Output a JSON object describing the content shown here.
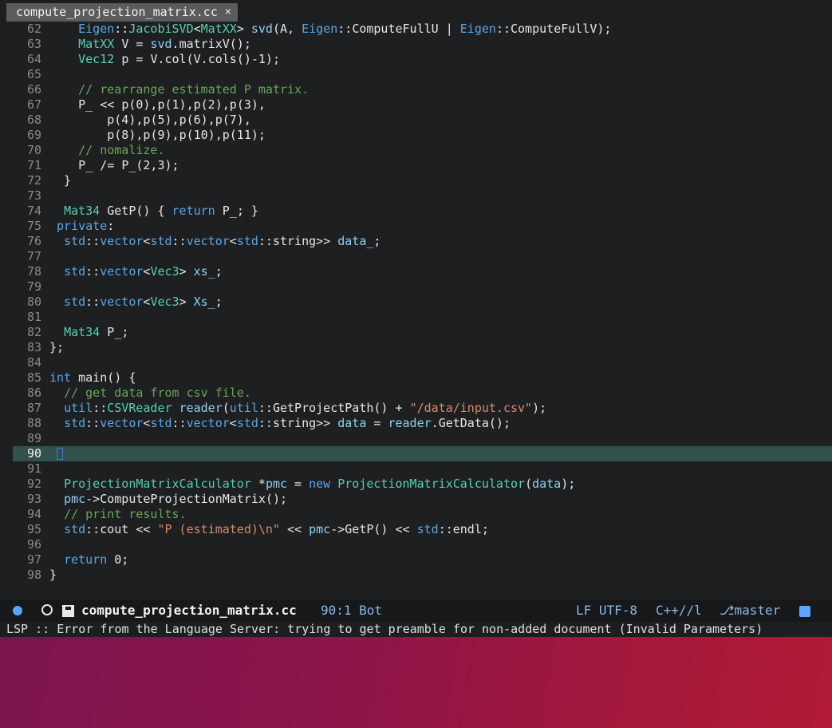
{
  "tab": {
    "filename": "compute_projection_matrix.cc",
    "close_glyph": "×"
  },
  "editor": {
    "current_line": 90,
    "lines": [
      {
        "n": "62",
        "t": "    Eigen::JacobiSVD<MatXX> svd(A, Eigen::ComputeFullU | Eigen::ComputeFullV);"
      },
      {
        "n": "63",
        "t": "    MatXX V = svd.matrixV();"
      },
      {
        "n": "64",
        "t": "    Vec12 p = V.col(V.cols()-1);"
      },
      {
        "n": "65",
        "t": ""
      },
      {
        "n": "66",
        "t": "    // rearrange estimated P matrix."
      },
      {
        "n": "67",
        "t": "    P_ << p(0),p(1),p(2),p(3),"
      },
      {
        "n": "68",
        "t": "        p(4),p(5),p(6),p(7),"
      },
      {
        "n": "69",
        "t": "        p(8),p(9),p(10),p(11);"
      },
      {
        "n": "70",
        "t": "    // nomalize."
      },
      {
        "n": "71",
        "t": "    P_ /= P_(2,3);"
      },
      {
        "n": "72",
        "t": "  }"
      },
      {
        "n": "73",
        "t": ""
      },
      {
        "n": "74",
        "t": "  Mat34 GetP() { return P_; }"
      },
      {
        "n": "75",
        "t": " private:"
      },
      {
        "n": "76",
        "t": "  std::vector<std::vector<std::string>> data_;"
      },
      {
        "n": "77",
        "t": ""
      },
      {
        "n": "78",
        "t": "  std::vector<Vec3> xs_;"
      },
      {
        "n": "79",
        "t": ""
      },
      {
        "n": "80",
        "t": "  std::vector<Vec3> Xs_;"
      },
      {
        "n": "81",
        "t": ""
      },
      {
        "n": "82",
        "t": "  Mat34 P_;"
      },
      {
        "n": "83",
        "t": "};"
      },
      {
        "n": "84",
        "t": ""
      },
      {
        "n": "85",
        "t": "int main() {"
      },
      {
        "n": "86",
        "t": "  // get data from csv file."
      },
      {
        "n": "87",
        "t": "  util::CSVReader reader(util::GetProjectPath() + \"/data/input.csv\");"
      },
      {
        "n": "88",
        "t": "  std::vector<std::vector<std::string>> data = reader.GetData();"
      },
      {
        "n": "89",
        "t": ""
      },
      {
        "n": "90",
        "t": ""
      },
      {
        "n": "91",
        "t": ""
      },
      {
        "n": "92",
        "t": "  ProjectionMatrixCalculator *pmc = new ProjectionMatrixCalculator(data);"
      },
      {
        "n": "93",
        "t": "  pmc->ComputeProjectionMatrix();"
      },
      {
        "n": "94",
        "t": "  // print results."
      },
      {
        "n": "95",
        "t": "  std::cout << \"P (estimated)\\n\" << pmc->GetP() << std::endl;"
      },
      {
        "n": "96",
        "t": ""
      },
      {
        "n": "97",
        "t": "  return 0;"
      },
      {
        "n": "98",
        "t": "}"
      }
    ]
  },
  "modeline": {
    "filename": "compute_projection_matrix.cc",
    "position": "90:1 Bot",
    "encoding": "LF UTF-8",
    "mode": "C++//l",
    "branch": "master",
    "branch_icon": "git-branch-icon"
  },
  "echo_area": {
    "message": "LSP :: Error from the Language Server: trying to get preamble for non-added document (Invalid Parameters)"
  },
  "colors": {
    "current_line_bg": "#33514c",
    "desktop_start": "#7c1450",
    "desktop_end": "#b01a35"
  }
}
